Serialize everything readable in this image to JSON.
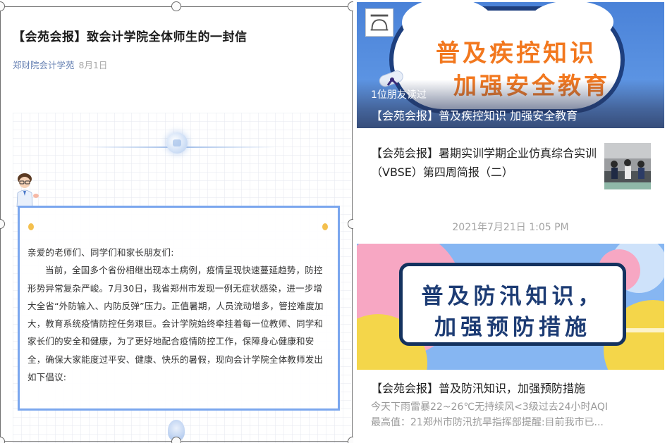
{
  "article": {
    "title": "【会苑会报】致会计学院全体师生的一封信",
    "source": "郑财院会计学苑",
    "date": "8月1日",
    "greeting": "亲爱的老师们、同学们和家长朋友们:",
    "body": "当前，全国多个省份相继出现本土病例，疫情呈现快速蔓延趋势，防控形势异常复杂严峻。7月30日，我省郑州市发现一例无症状感染，进一步增大全省“外防输入、内防反弹”压力。正值暑期，人员流动增多，管控难度加大，教育系统疫情防控任务艰巨。会计学院始终牵挂着每一位教师、同学和家长们的安全和健康，为了更好地配合疫情防控工作，保障身心健康和安全，确保大家能度过平安、健康、快乐的暑假，现向会计学院全体教师发出如下倡议:"
  },
  "feed": {
    "card1": {
      "banner_line1": "普及疾控知识",
      "banner_line2": "加强安全教育",
      "read_count": "1位朋友读过",
      "title": "【会苑会报】普及疾控知识 加强安全教育"
    },
    "card2": {
      "title": "【会苑会报】暑期实训学期企业仿真综合实训（VBSE）第四周简报（二）"
    },
    "timestamp": "2021年7月21日 1:05 PM",
    "card3": {
      "banner_line1": "普及防汛知识，",
      "banner_line2": "加强预防措施",
      "title": "【会苑会报】普及防汛知识，加强预防措施",
      "excerpt_line1": "今天下雨雷暴22~26℃无持续风<3级过去24小时AQI",
      "excerpt_line2": "最高值：21郑州市防汛抗旱指挥部提醒:目前我市已..."
    }
  },
  "colors": {
    "box_border": "#7aa6ee",
    "source_link": "#6a84b5",
    "banner_orange": "#f2781f",
    "banner_navy": "#1d3c74",
    "timestamp_gray": "#a4a4a4"
  }
}
